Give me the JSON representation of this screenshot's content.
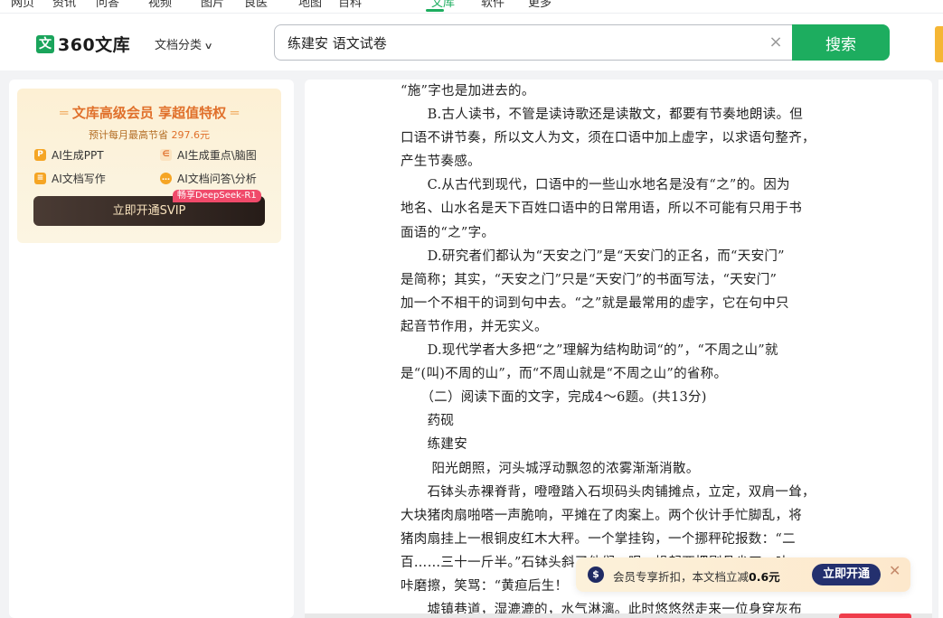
{
  "topnav": {
    "items": [
      "网页",
      "资讯",
      "问答",
      "视频",
      "图片",
      "良医",
      "地图",
      "百科",
      "文库",
      "软件",
      "更多"
    ],
    "active_index": 8
  },
  "header": {
    "logo_text": "360文库",
    "doc_category": "文档分类",
    "search": {
      "value": "练建安 语文试卷",
      "button": "搜索"
    }
  },
  "promo": {
    "title": "文库高级会员 享超值特权",
    "subtitle": "预计每月最高节省",
    "price": "297.6元",
    "features": [
      {
        "label": "AI生成PPT",
        "icon": "ppt-icon"
      },
      {
        "label": "AI生成重点\\脑图",
        "icon": "mindmap-icon"
      },
      {
        "label": "AI文档写作",
        "icon": "write-icon"
      },
      {
        "label": "AI文档问答\\分析",
        "icon": "chat-icon"
      }
    ],
    "badge": "畅享DeepSeek-R1",
    "button": "立即开通SVIP",
    "accent": "#e0702b"
  },
  "document": {
    "lines": [
      "“施”字也是加进去的。",
      "　　B.古人读书，不管是读诗歌还是读散文，都要有节奏地朗读。但",
      "口语不讲节奏，所以文人为文，须在口语中加上虚字，以求语句整齐，",
      "产生节奏感。",
      "　　C.从古代到现代，口语中的一些山水地名是没有“之”的。因为",
      "地名、山水名是天下百姓口语中的日常用语，所以不可能有只用于书",
      "面语的“之”字。",
      "　　D.研究者们都认为“天安之门”是“天安门的正名，而“天安门”",
      "是简称；其实，“天安之门”只是“天安门”的书面写法，“天安门”",
      "加一个不相干的词到句中去。“之”就是最常用的虚字，它在句中只",
      "起音节作用，并无实义。",
      "　　D.现代学者大多把“之”理解为结构助词“的”，“不周之山”就",
      "是“(叫)不周的山”，而“不周山就是“不周之山”的省称。",
      "　　（二）阅读下面的文字，完成4～6题。(共13分)",
      "　　药砚",
      "　　练建安",
      "　　 阳光朗照，河头城浮动飘忽的浓雾渐渐消散。",
      "　　石钵头赤裸脊背，噔噔踏入石坝码头肉铺摊点，立定，双肩一耸，",
      "大块猪肉扇啪嗒一声脆响，平摊在了肉案上。两个伙计手忙脚乱，将",
      "猪肉扇挂上一根铜皮红木大秤。一个掌挂钩，一个挪秤砣报数：“二",
      "百……三十一斤半。”石钵头斜了他们一眼，操起西把剔骨尖刀，咔",
      "咔磨擦，笑骂：“黄疸后生！",
      "　　墟镇巷道，湿漉漉的，水气淋漓。此时悠悠然走来一位身穿灰布"
    ]
  },
  "vip_tip": {
    "text_prefix": "会员专享折扣，本文档立减",
    "amount": "0.6元",
    "button": "立即开通"
  }
}
